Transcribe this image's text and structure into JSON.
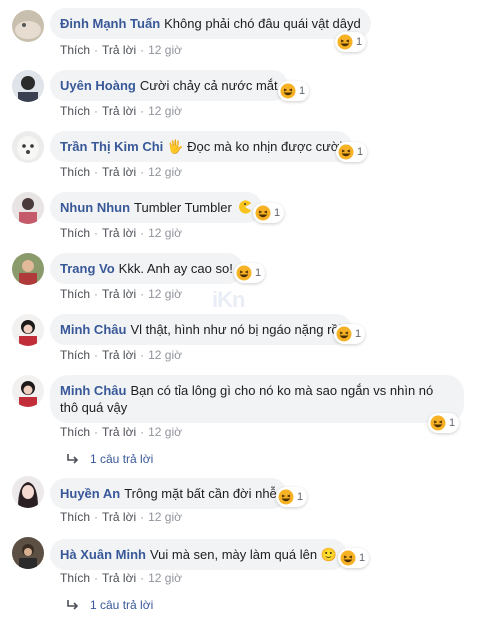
{
  "labels": {
    "like": "Thích",
    "reply": "Trả lời",
    "separator": "·"
  },
  "colors": {
    "name": "#385898",
    "bubble": "#f2f3f5",
    "meta": "#90949c",
    "haha_face": "#f7b125"
  },
  "comments": [
    {
      "name": "Đinh Mạnh Tuấn",
      "text": "Không phải chó đâu quái vật dâyd",
      "reaction": {
        "icon": "haha-icon",
        "count": "1"
      },
      "time": "12 giờ"
    },
    {
      "name": "Uyên Hoàng",
      "text": "Cười chảy cả nước mắt",
      "reaction": {
        "icon": "haha-icon",
        "count": "1"
      },
      "time": "12 giờ"
    },
    {
      "name": "Trần Thị Kim Chi",
      "text": "🖐 Đọc mà ko nhịn được cười",
      "reaction": {
        "icon": "haha-icon",
        "count": "1"
      },
      "time": "12 giờ"
    },
    {
      "name": "Nhun Nhun",
      "text": "Tumbler Tumbler",
      "reaction": {
        "icon": "haha-icon",
        "count": "1"
      },
      "time": "12 giờ"
    },
    {
      "name": "Trang Vo",
      "text": "Kkk. Anh ay cao so!",
      "reaction": {
        "icon": "haha-icon",
        "count": "1"
      },
      "time": "12 giờ"
    },
    {
      "name": "Minh Châu",
      "text": "Vl thật, hình như nó bị ngáo nặng rồi",
      "reaction": {
        "icon": "haha-icon",
        "count": "1"
      },
      "time": "12 giờ"
    },
    {
      "name": "Minh Châu",
      "text": "Bạn có tỉa lông gì cho nó ko mà sao ngắn vs nhìn nó thô quá vậy",
      "reaction": {
        "icon": "haha-icon",
        "count": "1"
      },
      "time": "12 giờ",
      "replies": "1 câu trả lời"
    },
    {
      "name": "Huyền An",
      "text": "Trông mặt bất cần đời nhễ",
      "reaction": {
        "icon": "haha-icon",
        "count": "1"
      },
      "time": "12 giờ"
    },
    {
      "name": "Hà Xuân Minh",
      "text": "Vui mà sen, mày làm quá lên 🙂",
      "reaction": {
        "icon": "haha-icon",
        "count": "1"
      },
      "time": "12 giờ",
      "replies": "1 câu trả lời"
    }
  ]
}
